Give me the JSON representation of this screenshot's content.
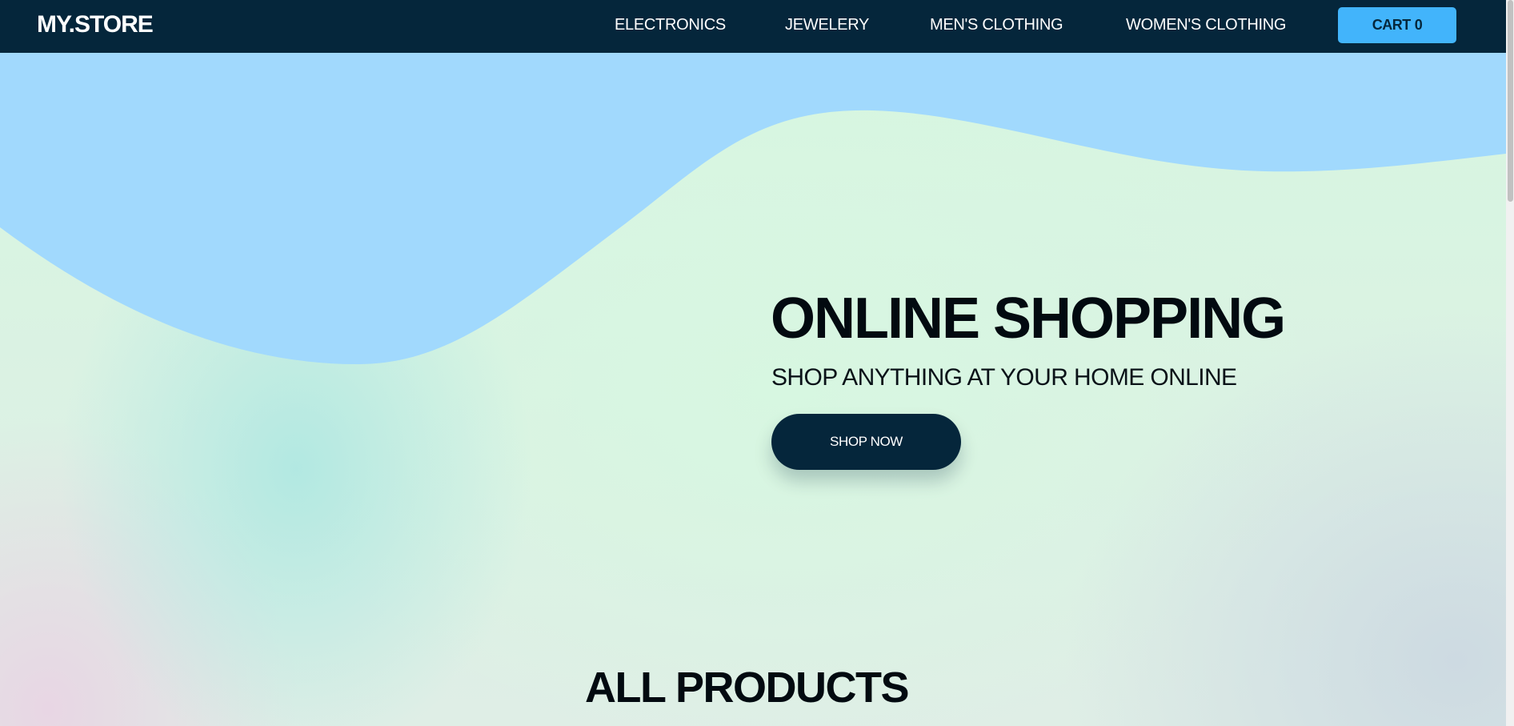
{
  "navbar": {
    "brand": "MY.STORE",
    "links": [
      {
        "label": "ELECTRONICS"
      },
      {
        "label": "JEWELERY"
      },
      {
        "label": "MEN'S CLOTHING"
      },
      {
        "label": "WOMEN'S CLOTHING"
      }
    ],
    "cart": {
      "label": "CART",
      "count": "0"
    }
  },
  "hero": {
    "title": "ONLINE SHOPPING",
    "subtitle": "SHOP ANYTHING AT YOUR HOME ONLINE",
    "cta_label": "SHOP NOW"
  },
  "products": {
    "heading": "ALL PRODUCTS"
  },
  "colors": {
    "navbar_bg": "#05263b",
    "cart_accent": "#42b4fb",
    "wave_blue": "#a1d9fd",
    "text_dark": "#020a10"
  }
}
